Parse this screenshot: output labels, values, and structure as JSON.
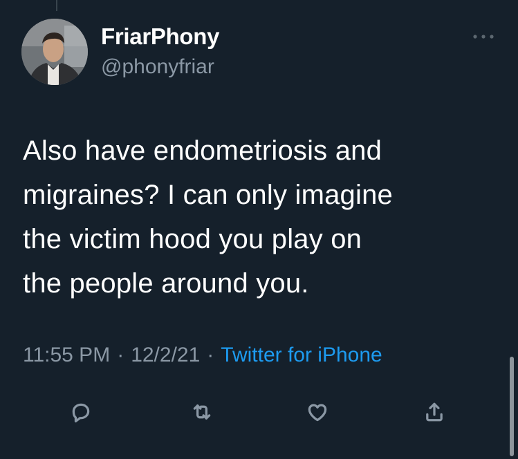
{
  "user": {
    "display_name": "FriarPhony",
    "handle": "@phonyfriar",
    "avatar_icon": "profile-photo"
  },
  "tweet": {
    "text": "Also have endometriosis and\nmigraines? I can only imagine\nthe victim hood you play on\nthe people around you."
  },
  "meta": {
    "time": "11:55 PM",
    "separator": "·",
    "date": "12/2/21",
    "source": "Twitter for iPhone"
  },
  "actions": [
    {
      "name": "reply",
      "icon": "reply-icon"
    },
    {
      "name": "retweet",
      "icon": "retweet-icon"
    },
    {
      "name": "like",
      "icon": "heart-icon"
    },
    {
      "name": "share",
      "icon": "share-icon"
    }
  ],
  "colors": {
    "background": "#15202b",
    "primary_text": "#ffffff",
    "secondary_text": "#8b98a5",
    "link": "#1d9bf0"
  }
}
